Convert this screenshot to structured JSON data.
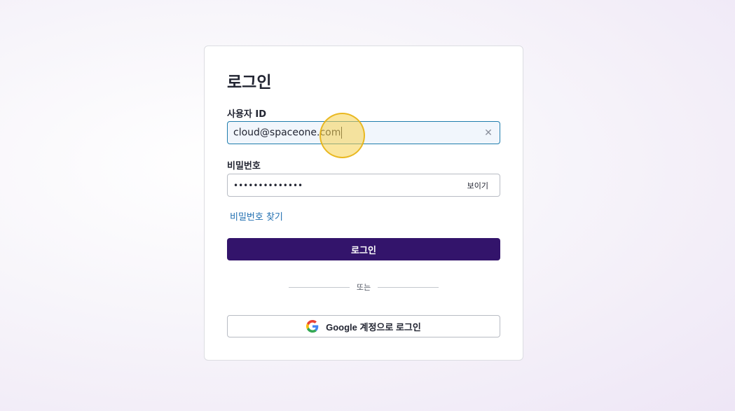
{
  "login": {
    "title": "로그인",
    "user_id_label": "사용자 ID",
    "user_id_value": "cloud@spaceone.com",
    "clear_icon": "close-icon",
    "password_label": "비밀번호",
    "password_masked": "••••••••••••••",
    "show_label": "보이기",
    "forgot_link": "비밀번호 찾기",
    "submit_label": "로그인",
    "divider_text": "또는",
    "google_label": "Google 계정으로 로그인",
    "google_icon": "google-icon"
  },
  "colors": {
    "primary": "#33146b",
    "link": "#1f6eb0",
    "focus_border": "#1f7dad"
  }
}
